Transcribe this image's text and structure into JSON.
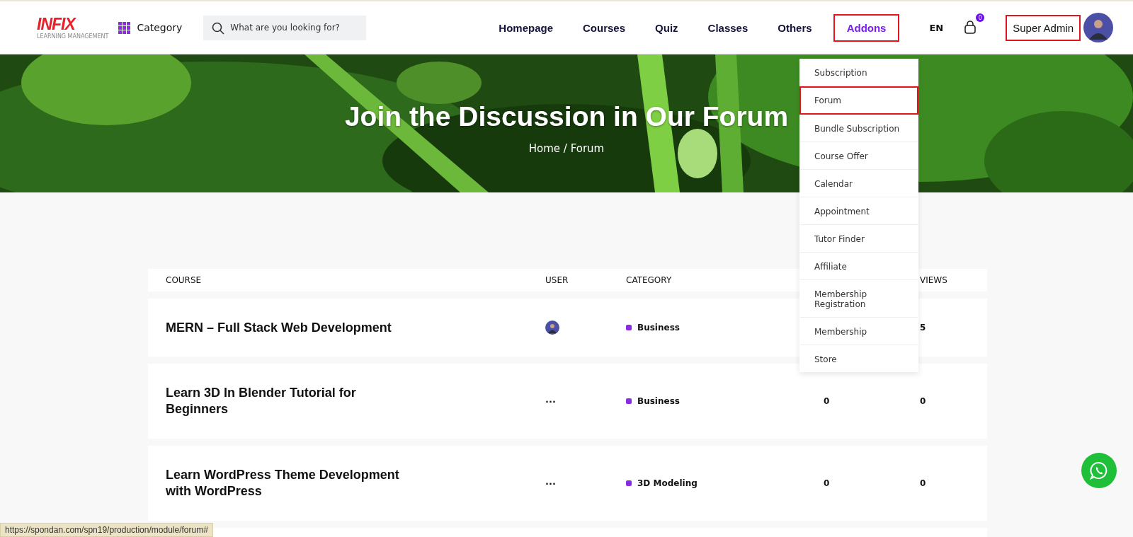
{
  "header": {
    "logo": {
      "text": "INFIX",
      "tagline": "LEARNING MANAGEMENT"
    },
    "category": "Category",
    "search": {
      "placeholder": "What are you looking for?"
    },
    "nav": [
      {
        "label": "Homepage",
        "selected": false,
        "highlighted": false
      },
      {
        "label": "Courses",
        "selected": false,
        "highlighted": false
      },
      {
        "label": "Quiz",
        "selected": false,
        "highlighted": false
      },
      {
        "label": "Classes",
        "selected": false,
        "highlighted": false
      },
      {
        "label": "Others",
        "selected": false,
        "highlighted": false
      },
      {
        "label": "Addons",
        "selected": true,
        "highlighted": true
      }
    ],
    "language": "EN",
    "cart_count": "0",
    "user": {
      "name": "Super Admin",
      "highlighted": true
    }
  },
  "hero": {
    "kind": "picture",
    "title": "Join the Discussion in Our Forum",
    "breadcrumb": "Home / Forum"
  },
  "addons_menu": [
    {
      "label": "Subscription",
      "highlighted": false
    },
    {
      "label": "Forum",
      "highlighted": true
    },
    {
      "label": "Bundle Subscription",
      "highlighted": false
    },
    {
      "label": "Course Offer",
      "highlighted": false
    },
    {
      "label": "Calendar",
      "highlighted": false
    },
    {
      "label": "Appointment",
      "highlighted": false
    },
    {
      "label": "Tutor Finder",
      "highlighted": false
    },
    {
      "label": "Affiliate",
      "highlighted": false
    },
    {
      "label": "Membership Registration",
      "highlighted": false
    },
    {
      "label": "Membership",
      "highlighted": false
    },
    {
      "label": "Store",
      "highlighted": false
    }
  ],
  "table": {
    "columns": [
      "COURSE",
      "USER",
      "CATEGORY",
      "",
      "VIEWS"
    ],
    "rows": [
      {
        "course": "MERN – Full Stack Web Development",
        "user": {
          "kind": "avatar"
        },
        "category": "Business",
        "column_4": "",
        "views": "5"
      },
      {
        "course": "Learn 3D In Blender Tutorial for Beginners",
        "user": {
          "kind": "more",
          "text": "···"
        },
        "category": "Business",
        "column_4": "0",
        "views": "0"
      },
      {
        "course": "Learn WordPress Theme Development with WordPress",
        "user": {
          "kind": "more",
          "text": "···"
        },
        "category": "3D Modeling",
        "column_4": "0",
        "views": "0"
      }
    ]
  },
  "status_bar": {
    "url": "https://spondan.com/spn19/production/module/forum#"
  }
}
